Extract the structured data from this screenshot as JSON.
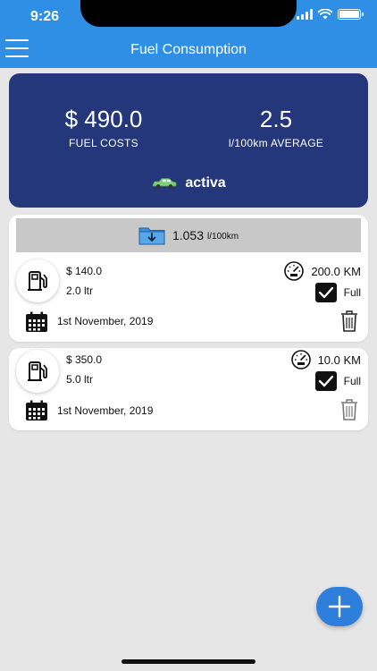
{
  "status": {
    "time": "9:26"
  },
  "nav": {
    "title": "Fuel Consumption"
  },
  "summary": {
    "fuel_costs_value": "$ 490.0",
    "fuel_costs_label": "FUEL COSTS",
    "average_value": "2.5",
    "average_label": "l/100km AVERAGE",
    "vehicle_name": "activa"
  },
  "group": {
    "average_value": "1.053",
    "average_unit": "l/100km"
  },
  "records": [
    {
      "cost": "$ 140.0",
      "volume": "2.0 ltr",
      "odometer": "200.0 KM",
      "full_label": "Full",
      "date": "1st November, 2019"
    },
    {
      "cost": "$ 350.0",
      "volume": "5.0 ltr",
      "odometer": "10.0 KM",
      "full_label": "Full",
      "date": "1st November, 2019"
    }
  ],
  "colors": {
    "nav_blue": "#2f8fe5",
    "summary_navy": "#23377a",
    "fab_blue": "#2e7fdc",
    "background": "#e6e6e6"
  },
  "icons": {
    "menu": "menu-icon",
    "car": "car-icon",
    "folder_download": "folder-download-icon",
    "fuel_pump": "fuel-pump-icon",
    "odometer": "odometer-icon",
    "checkbox": "checkbox-checked-icon",
    "calendar": "calendar-icon",
    "trash": "trash-icon",
    "add": "plus-icon"
  }
}
